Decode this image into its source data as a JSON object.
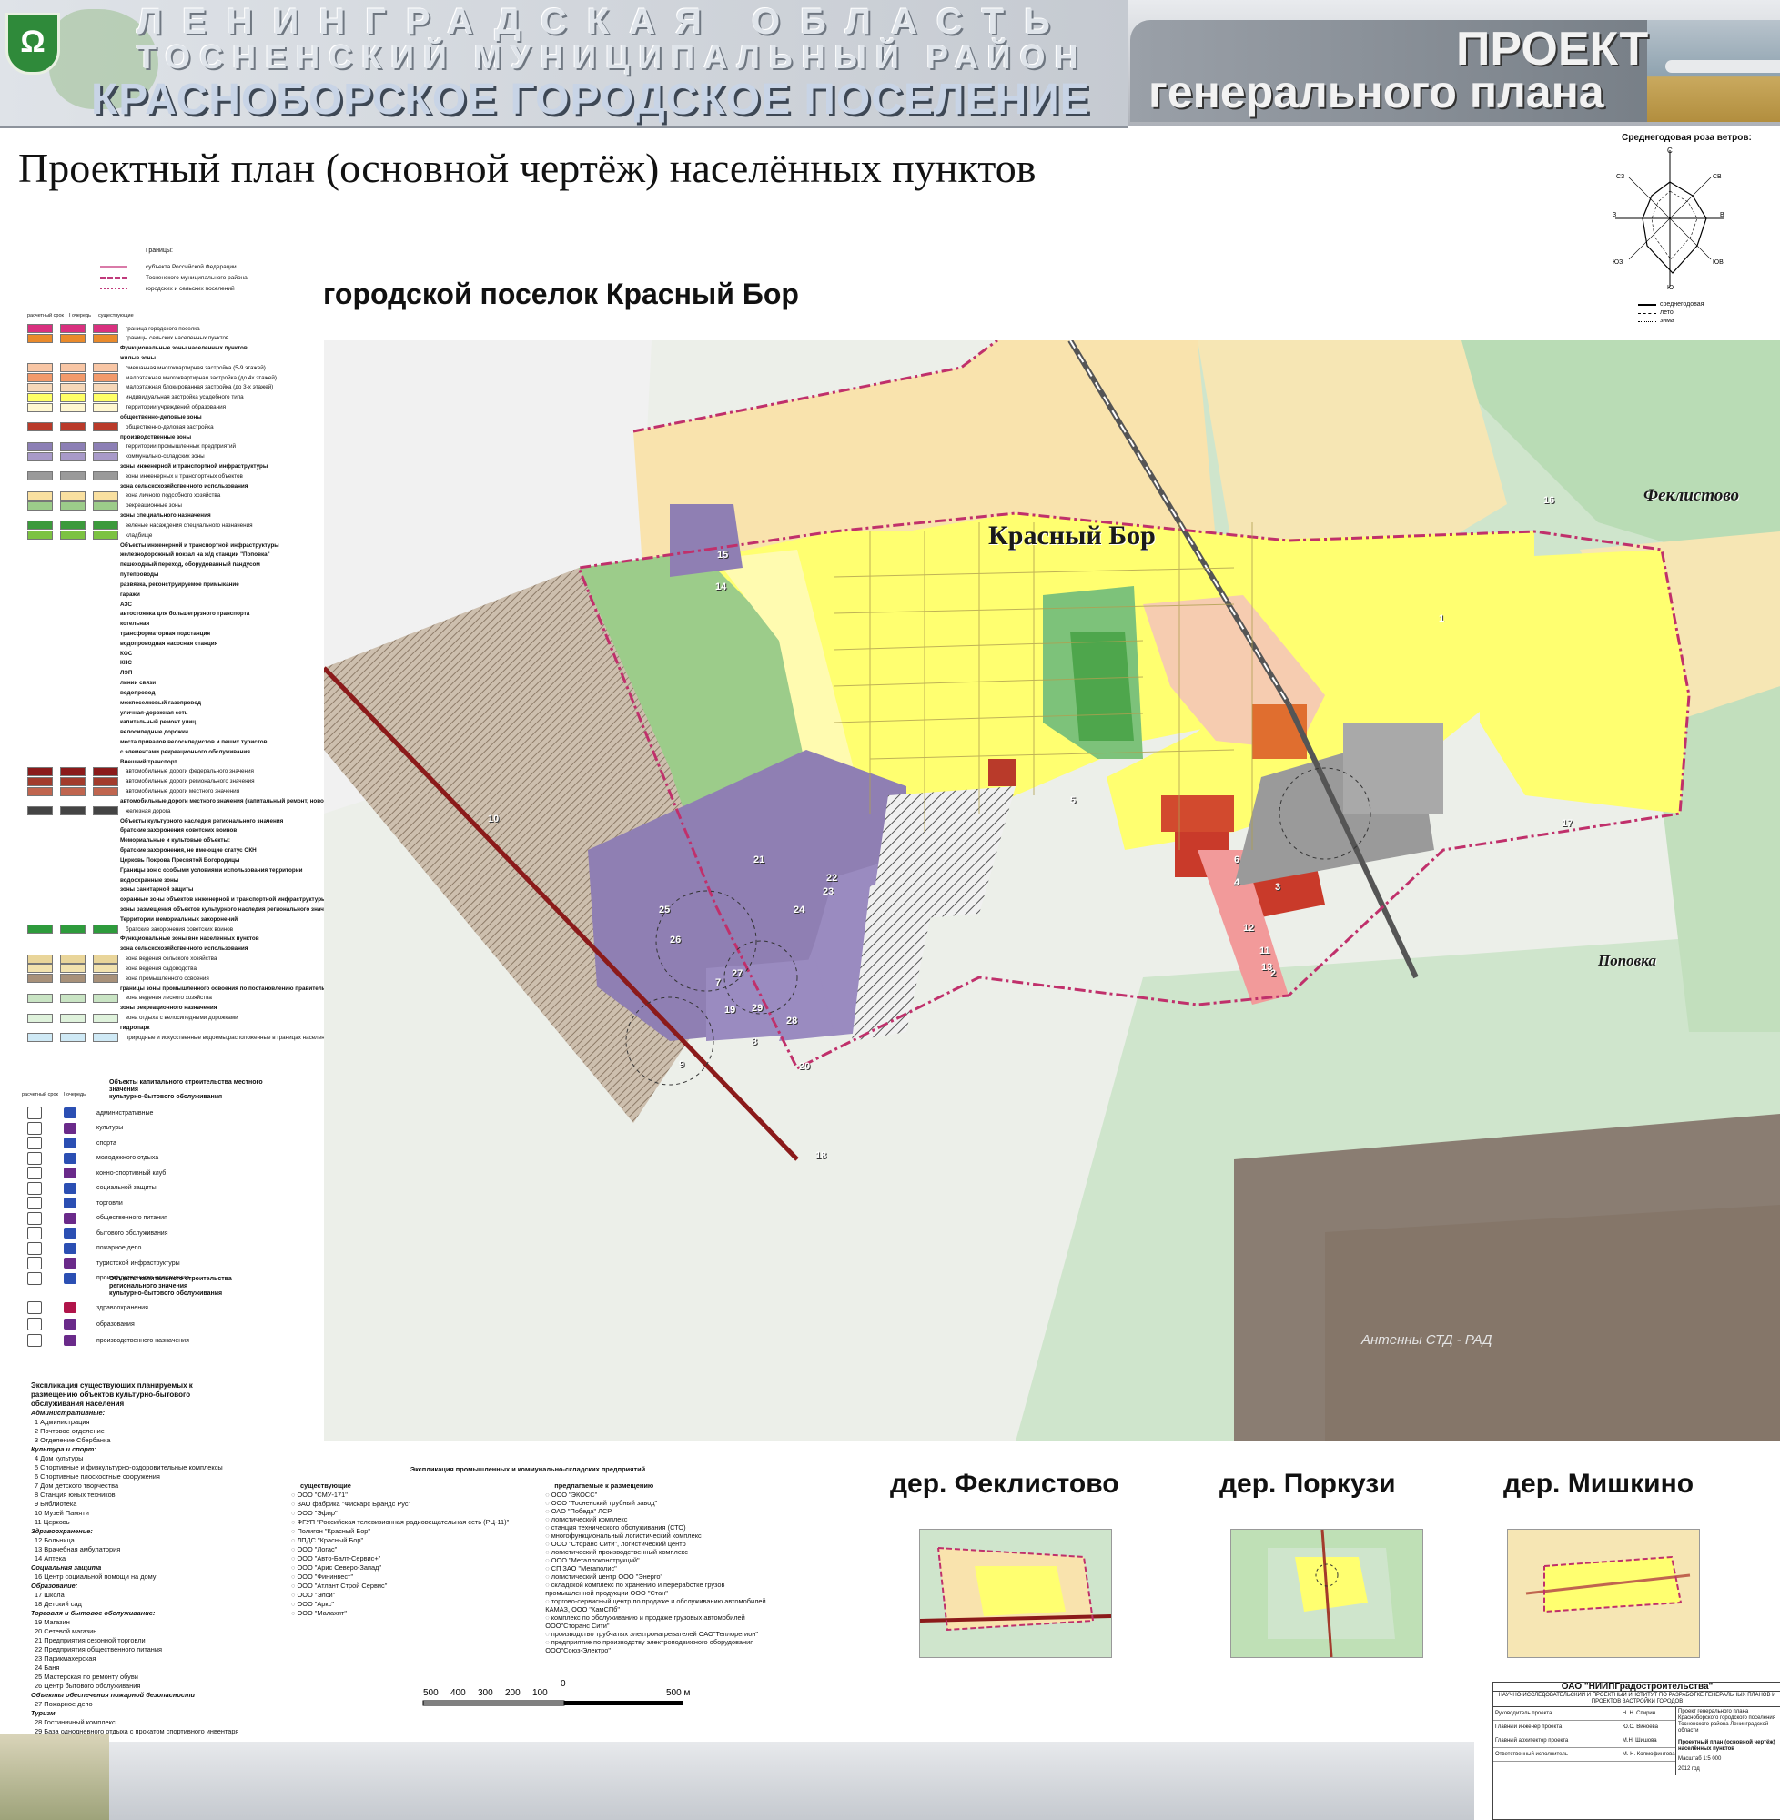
{
  "header": {
    "line1": "ЛЕНИНГРАДСКАЯ ОБЛАСТЬ",
    "line2": "ТОСНЕНСКИЙ МУНИЦИПАЛЬНЫЙ РАЙОН",
    "line3": "КРАСНОБОРСКОЕ ГОРОДСКОЕ ПОСЕЛЕНИЕ",
    "project1": "ПРОЕКТ",
    "project2": "генерального плана"
  },
  "title": "Проектный план (основной чертёж) населённых пунктов",
  "subtitle": "городской поселок Красный Бор",
  "wind": {
    "label": "Среднегодовая роза ветров:",
    "directions": [
      "С",
      "СВ",
      "В",
      "ЮВ",
      "Ю",
      "ЮЗ",
      "З",
      "СЗ"
    ],
    "legend": [
      "среднегодовая",
      "лето",
      "зима"
    ]
  },
  "legend": {
    "borders_title": "Границы:",
    "borders": [
      "субъекта Российской Федерации",
      "Тосненского муниципального района",
      "городских и сельских поселений"
    ],
    "columns": [
      "расчетный срок",
      "I очередь",
      "существующие"
    ],
    "items": [
      {
        "text": "граница городского поселка",
        "color": "#d9307f"
      },
      {
        "text": "границы сельских населенных пунктов",
        "color": "#e98a2b"
      },
      {
        "text": "Функциональные зоны населенных пунктов",
        "color": ""
      },
      {
        "text": "жилые зоны",
        "color": ""
      },
      {
        "text": "смешанная многоквартирная застройка (5-9 этажей)",
        "color": "#f8c6a5"
      },
      {
        "text": "малоэтажная многоквартирная застройка (до 4х этажей)",
        "color": "#f29a6b"
      },
      {
        "text": "малоэтажная блокированная застройка (до 3-х этажей)",
        "color": "#f6d7b8"
      },
      {
        "text": "индивидуальная застройка усадебного типа",
        "color": "#ffff66"
      },
      {
        "text": "территории учреждений образования",
        "color": "#fff7d0"
      },
      {
        "text": "общественно-деловые зоны",
        "color": ""
      },
      {
        "text": "общественно-деловая застройка",
        "color": "#b93a2a"
      },
      {
        "text": "производственные зоны",
        "color": ""
      },
      {
        "text": "территории промышленных предприятий",
        "color": "#8c7fb5"
      },
      {
        "text": "коммунально-складских зоны",
        "color": "#a89ac9"
      },
      {
        "text": "зоны инженерной и транспортной инфраструктуры",
        "color": ""
      },
      {
        "text": "зоны инженерных и транспортных объектов",
        "color": "#9a9a9a"
      },
      {
        "text": "зона сельскохозяйственного использования",
        "color": ""
      },
      {
        "text": "зона личного подсобного хозяйства",
        "color": "#f9e0a0"
      },
      {
        "text": "рекреационные зоны",
        "color": "#9ccc8a"
      },
      {
        "text": "зоны специального назначения",
        "color": ""
      },
      {
        "text": "зеленые насаждения специального назначения",
        "color": "#3c9a3c"
      },
      {
        "text": "кладбище",
        "color": "#7cc242"
      },
      {
        "text": "Объекты инженерной и транспортной инфраструктуры",
        "color": ""
      },
      {
        "text": "железнодорожный вокзал на ж/д станции \"Поповка\"",
        "color": ""
      },
      {
        "text": "пешеходный переход, оборудованный пандусом",
        "color": ""
      },
      {
        "text": "путепроводы",
        "color": ""
      },
      {
        "text": "развязка, реконструируемое примыкание",
        "color": ""
      },
      {
        "text": "гаражи",
        "color": ""
      },
      {
        "text": "АЗС",
        "color": ""
      },
      {
        "text": "автостоянка для большегрузного транспорта",
        "color": ""
      },
      {
        "text": "котельная",
        "color": ""
      },
      {
        "text": "трансформаторная подстанция",
        "color": ""
      },
      {
        "text": "водопроводная насосная станция",
        "color": ""
      },
      {
        "text": "КОС",
        "color": ""
      },
      {
        "text": "КНС",
        "color": ""
      },
      {
        "text": "ЛЭП",
        "color": ""
      },
      {
        "text": "линии связи",
        "color": ""
      },
      {
        "text": "водопровод",
        "color": ""
      },
      {
        "text": "межпоселковый газопровод",
        "color": ""
      },
      {
        "text": "уличная-дорожная сеть",
        "color": ""
      },
      {
        "text": "капитальный ремонт улиц",
        "color": ""
      },
      {
        "text": "велосипедные дорожки",
        "color": ""
      },
      {
        "text": "места привалов велосипедистов и пеших туристов",
        "color": ""
      },
      {
        "text": "с элементами рекреационного обслуживания",
        "color": ""
      },
      {
        "text": "Внешний транспорт",
        "color": ""
      },
      {
        "text": "автомобильные дороги федерального значения",
        "color": "#8b1a1a"
      },
      {
        "text": "автомобильные дороги регионального значения",
        "color": "#a33b2c"
      },
      {
        "text": "автомобильные дороги местного значения",
        "color": "#c0654f"
      },
      {
        "text": "автомобильные дороги местного значения (капитальный ремонт, новое строительство)",
        "color": ""
      },
      {
        "text": "железная дорога",
        "color": "#444444"
      },
      {
        "text": "Объекты культурного наследия регионального значения",
        "color": ""
      },
      {
        "text": "братские захоронения советских воинов",
        "color": ""
      },
      {
        "text": "Мемориальные и культовые объекты:",
        "color": ""
      },
      {
        "text": "братские захоронения, не имеющие статус ОКН",
        "color": ""
      },
      {
        "text": "Церковь Покрова Пресвятой Богородицы",
        "color": ""
      },
      {
        "text": "Границы зон с особыми условиями использования территории",
        "color": ""
      },
      {
        "text": "водоохранные зоны",
        "color": ""
      },
      {
        "text": "зоны санитарной защиты",
        "color": ""
      },
      {
        "text": "охранные зоны объектов инженерной и транспортной инфраструктуры",
        "color": ""
      },
      {
        "text": "зоны размещения объектов культурного наследия регионального значения",
        "color": ""
      },
      {
        "text": "Территории мемориальных захоронений",
        "color": ""
      },
      {
        "text": "братские захоронения советских воинов",
        "color": "#2e9b3c"
      },
      {
        "text": "Функциональные зоны вне населенных пунктов",
        "color": ""
      },
      {
        "text": "зона сельскохозяйственного использования",
        "color": ""
      },
      {
        "text": "зона ведения сельского хозяйства",
        "color": "#e9d59a"
      },
      {
        "text": "зона ведения садоводства",
        "color": "#f2e2ae"
      },
      {
        "text": "зона промышленного освоения",
        "color": "#a8917a"
      },
      {
        "text": "границы зоны промышленного освоения по постановлению правительства ЛО от 28.11.2006г.№323",
        "color": ""
      },
      {
        "text": "зона ведения лесного хозяйства",
        "color": "#c9e4c4"
      },
      {
        "text": "зоны рекреационного назначения",
        "color": ""
      },
      {
        "text": "зона отдыха с велосипедными дорожками",
        "color": "#dff2dc"
      },
      {
        "text": "гидропарк",
        "color": ""
      },
      {
        "text": "природные и искусственные водоемы,расположенные в границах населенных пунктов, на землях сельхозназначения, промышленности территорий, лесном фонде",
        "color": "#cfe9f5"
      }
    ]
  },
  "objects_legend": {
    "columns": [
      "расчетный срок",
      "I очередь"
    ],
    "title": "Объекты капитального строительства местного значения",
    "subtitle": "культурно-бытового обслуживания",
    "items": [
      "административные",
      "культуры",
      "спорта",
      "молодежного отдыха",
      "конно-спортивный клуб",
      "социальной защиты",
      "торговли",
      "общественного питания",
      "бытового обслуживания",
      "пожарное депо",
      "туристской инфраструктуры",
      "производственного назначения"
    ],
    "regional_title": "Объекты капитального строительства регионального значения",
    "regional_sub": "культурно-бытового обслуживания",
    "regional_items": [
      "здравоохранения",
      "образования",
      "производственного назначения"
    ]
  },
  "map_labels": {
    "krasny_bor": "Красный Бор",
    "feklistovo": "Феклистово",
    "popovka": "Поповка",
    "antennas": "Антенны СТД - РАД"
  },
  "map_numbers": [
    "14",
    "15",
    "21",
    "22",
    "23",
    "24",
    "25",
    "26",
    "27",
    "7",
    "8",
    "29",
    "28",
    "20",
    "9",
    "19",
    "18",
    "3",
    "12",
    "11",
    "13",
    "2",
    "10",
    "17",
    "6",
    "4",
    "5",
    "16",
    "1"
  ],
  "explication1": {
    "title": "Экспликация существующих планируемых к размещению объектов культурно-бытового обслуживания населения",
    "groups": [
      {
        "name": "Административные:",
        "items": [
          "1 Администрация",
          "2 Почтовое отделение",
          "3 Отделение Сбербанка"
        ]
      },
      {
        "name": "Культура и спорт:",
        "items": [
          "4 Дом культуры",
          "5 Спортивные и физкультурно-оздоровительные комплексы",
          "6 Спортивные плоскостные сооружения",
          "7 Дом детского творчества",
          "8 Станция юных техников",
          "9 Библиотека",
          "10 Музей Памяти",
          "11 Церковь"
        ]
      },
      {
        "name": "Здравоохранение:",
        "items": [
          "12 Больница",
          "13 Врачебная амбулатория",
          "14 Аптека"
        ]
      },
      {
        "name": "Социальная защита",
        "items": [
          "16 Центр социальной помощи на дому"
        ]
      },
      {
        "name": "Образование:",
        "items": [
          "17 Школа",
          "18 Детский сад"
        ]
      },
      {
        "name": "Торговля и бытовое обслуживание:",
        "items": [
          "19 Магазин",
          "20 Сетевой магазин",
          "21 Предприятия сезонной торговли",
          "22 Предприятия общественного питания",
          "23 Парикмахерская",
          "24 Баня",
          "25 Мастерская по ремонту обуви",
          "26 Центр бытового обслуживания"
        ]
      },
      {
        "name": "Объекты обеспечения пожарной безопасности",
        "items": [
          "27 Пожарное депо"
        ]
      },
      {
        "name": "Туризм",
        "items": [
          "28 Гостиничный комплекс",
          "29 База однодневного отдыха с прокатом спортивного инвентаря"
        ]
      }
    ]
  },
  "explication2": {
    "title": "Экспликация промышленных и коммунально-складских предприятий",
    "existing_title": "существующие",
    "planned_title": "предлагаемые к размещению",
    "existing": [
      "ООО \"СМУ-171\"",
      "ЗАО фабрика \"Фискарс Брандс Рус\"",
      "ООО \"Эфир\"",
      "ФГУП \"Российская телевизионная радиовещательная сеть (РЦ-11)\"",
      "Полигон \"Красный Бор\"",
      "ЛПДС \"Красный Бор\"",
      "ООО \"Логас\"",
      "ООО \"Авто-Балт-Сервис+\"",
      "ООО \"Арис Северо-Запад\"",
      "ООО \"Фининвест\"",
      "ООО \"Атлант Строй Сервис\"",
      "ООО \"Элси\"",
      "ООО \"Аркс\"",
      "ООО \"Малахит\""
    ],
    "planned": [
      "ООО \"ЭКОСС\"",
      "ООО \"Тосненский трубный завод\"",
      "ОАО \"Победа\" ЛСР",
      "логистический комплекс",
      "станция технического обслуживания (СТО)",
      "многофункциональный логистический комплекс",
      "ООО \"Сторанс Сити\", логистический центр",
      "логистический производственный комплекс",
      "ООО \"Металлоконструкций\"",
      "СП ЗАО \"Мегаполис\"",
      "логистический центр ООО \"Энерго\"",
      "складской комплекс по хранению и переработке грузов промышленной продукции ООО \"Стан\"",
      "торгово-сервисный центр по продаже и обслуживанию автомобилей КАМАЗ, ООО \"КамСПб\"",
      "комплекс по обслуживанию и продаже грузовых автомобилей ООО\"Сторанс Сити\"",
      "производство трубчатых электронагревателей ОАО\"Теплорегион\"",
      "предприятие по производству электроподвижного оборудования ООО\"Союз-Электро\""
    ]
  },
  "settlements": [
    "дер. Феклистово",
    "дер. Поркузи",
    "дер. Мишкино"
  ],
  "scale": {
    "left_labels": [
      "500",
      "400",
      "300",
      "200",
      "100",
      "0"
    ],
    "right_label": "500 м"
  },
  "stamp": {
    "company": "ОАО \"НИИПГрадостроительства\"",
    "institute": "НАУЧНО-ИССЛЕДОВАТЕЛЬСКИЙ И ПРОЕКТНЫЙ ИНСТИТУТ ПО РАЗРАБОТКЕ ГЕНЕРАЛЬНЫХ ПЛАНОВ И ПРОЕКТОВ ЗАСТРОЙКИ ГОРОДОВ",
    "rows": [
      [
        "Руководитель проекта",
        "",
        "Н. Н. Спирин"
      ],
      [
        "Главный инженер проекта",
        "",
        "Ю.С. Виноева"
      ],
      [
        "Главный архитектор проекта",
        "",
        "М.Н. Шишова"
      ],
      [
        "Ответственный исполнитель",
        "",
        "М. Н. Колмофинтова"
      ]
    ],
    "project_title": "Проект генерального плана Красноборского городского поселения Тосненского района Ленинградской области",
    "scheme": "Проектный план (основной чертёж) населённых пунктов",
    "scale_txt": "Масштаб 1:5 000",
    "year": "2012 год"
  }
}
